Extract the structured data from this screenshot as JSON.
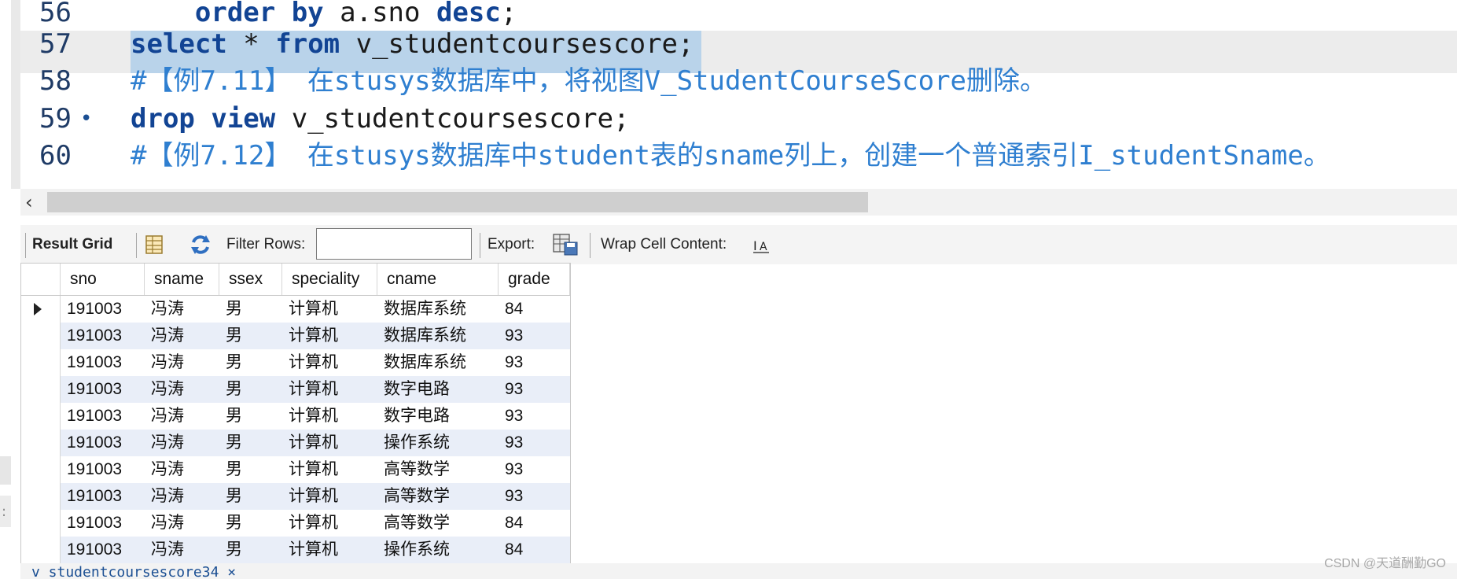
{
  "editor": {
    "lines": [
      {
        "num": "56",
        "parts": [
          {
            "t": "    ",
            "c": ""
          },
          {
            "t": "order by",
            "c": "kw"
          },
          {
            "t": " a.sno ",
            "c": ""
          },
          {
            "t": "desc",
            "c": "kw"
          },
          {
            "t": ";",
            "c": ""
          }
        ]
      },
      {
        "num": "57",
        "parts": [
          {
            "t": "select",
            "c": "kw"
          },
          {
            "t": " * ",
            "c": ""
          },
          {
            "t": "from",
            "c": "kw"
          },
          {
            "t": " v_studentcoursescore;",
            "c": ""
          }
        ]
      },
      {
        "num": "58",
        "parts": [
          {
            "t": "#【例7.11】 在stusys数据库中，将视图V_StudentCourseScore删除。",
            "c": "cm"
          }
        ]
      },
      {
        "num": "59",
        "bullet": "•",
        "parts": [
          {
            "t": "drop view",
            "c": "kw"
          },
          {
            "t": " v_studentcoursescore;",
            "c": ""
          }
        ]
      },
      {
        "num": "60",
        "parts": [
          {
            "t": "#【例7.12】 在stusys数据库中student表的sname列上，创建一个普通索引I_studentSname。",
            "c": "cm"
          }
        ]
      }
    ]
  },
  "toolbar": {
    "result_grid_label": "Result Grid",
    "filter_rows_label": "Filter Rows:",
    "filter_rows_value": "",
    "export_label": "Export:",
    "wrap_cell_label": "Wrap Cell Content:"
  },
  "grid": {
    "columns": [
      "sno",
      "sname",
      "ssex",
      "speciality",
      "cname",
      "grade"
    ],
    "rows": [
      [
        "191003",
        "冯涛",
        "男",
        "计算机",
        "数据库系统",
        "84"
      ],
      [
        "191003",
        "冯涛",
        "男",
        "计算机",
        "数据库系统",
        "93"
      ],
      [
        "191003",
        "冯涛",
        "男",
        "计算机",
        "数据库系统",
        "93"
      ],
      [
        "191003",
        "冯涛",
        "男",
        "计算机",
        "数字电路",
        "93"
      ],
      [
        "191003",
        "冯涛",
        "男",
        "计算机",
        "数字电路",
        "93"
      ],
      [
        "191003",
        "冯涛",
        "男",
        "计算机",
        "操作系统",
        "93"
      ],
      [
        "191003",
        "冯涛",
        "男",
        "计算机",
        "高等数学",
        "93"
      ],
      [
        "191003",
        "冯涛",
        "男",
        "计算机",
        "高等数学",
        "93"
      ],
      [
        "191003",
        "冯涛",
        "男",
        "计算机",
        "高等数学",
        "84"
      ],
      [
        "191003",
        "冯涛",
        "男",
        "计算机",
        "操作系统",
        "84"
      ]
    ]
  },
  "bottom_tab": {
    "label": "v_studentcoursescore34 ×"
  },
  "watermark": "CSDN @天道酬勤GO",
  "colors": {
    "keyword": "#124494",
    "comment": "#2f7fd0",
    "selection": "#b9d3ea",
    "row_alt": "#e9eef8"
  }
}
